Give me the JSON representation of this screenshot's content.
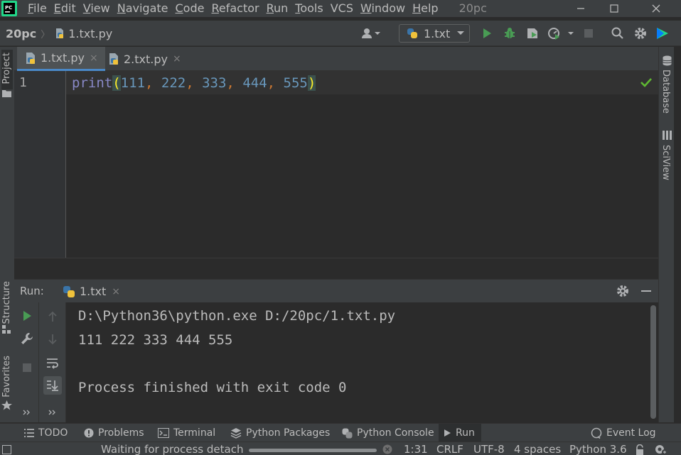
{
  "app": {
    "window_title": "20pc",
    "logo_text": "PC"
  },
  "menu": [
    {
      "mnemonic": "F",
      "rest": "ile"
    },
    {
      "mnemonic": "E",
      "rest": "dit"
    },
    {
      "mnemonic": "V",
      "rest": "iew"
    },
    {
      "mnemonic": "N",
      "rest": "avigate"
    },
    {
      "mnemonic": "C",
      "rest": "ode"
    },
    {
      "mnemonic": "R",
      "rest": "efactor"
    },
    {
      "mnemonic": "R",
      "rest": "un"
    },
    {
      "mnemonic": "T",
      "rest": "ools"
    },
    {
      "mnemonic": "",
      "rest": "VCS"
    },
    {
      "mnemonic": "W",
      "rest": "indow"
    },
    {
      "mnemonic": "H",
      "rest": "elp"
    }
  ],
  "navbar": {
    "project": "20pc",
    "file": "1.txt.py",
    "run_config": "1.txt"
  },
  "left_strip": {
    "project": "Project",
    "structure": "Structure",
    "favorites": "Favorites"
  },
  "right_strip": {
    "database": "Database",
    "sciview": "SciView"
  },
  "editor_tabs": [
    {
      "label": "1.txt.py",
      "close": "×"
    },
    {
      "label": "2.txt.py",
      "close": "×"
    }
  ],
  "editor": {
    "line_number": "1",
    "code": {
      "fn": "print",
      "open": "(",
      "n1": "111",
      "n2": "222",
      "n3": "333",
      "n4": "444",
      "n5": "555",
      "comma": ", ",
      "close": ")"
    }
  },
  "run_panel": {
    "title": "Run:",
    "tab_label": "1.txt",
    "tab_close": "×",
    "console_lines": [
      "D:\\Python36\\python.exe D:/20pc/1.txt.py",
      "111 222 333 444 555",
      "",
      "Process finished with exit code 0"
    ]
  },
  "bottom_bar": {
    "todo": "TODO",
    "problems": "Problems",
    "terminal": "Terminal",
    "python_packages": "Python Packages",
    "python_console": "Python Console",
    "run": "Run",
    "event_log": "Event Log"
  },
  "status_bar": {
    "message": "Waiting for process detach",
    "progress_percent": 100,
    "position": "1:31",
    "line_separator": "CRLF",
    "encoding": "UTF-8",
    "indent": "4 spaces",
    "interpreter": "Python 3.6"
  },
  "colors": {
    "run_green": "#499c54",
    "accent_blue": "#4a88c7",
    "check_green": "#5fb832"
  }
}
